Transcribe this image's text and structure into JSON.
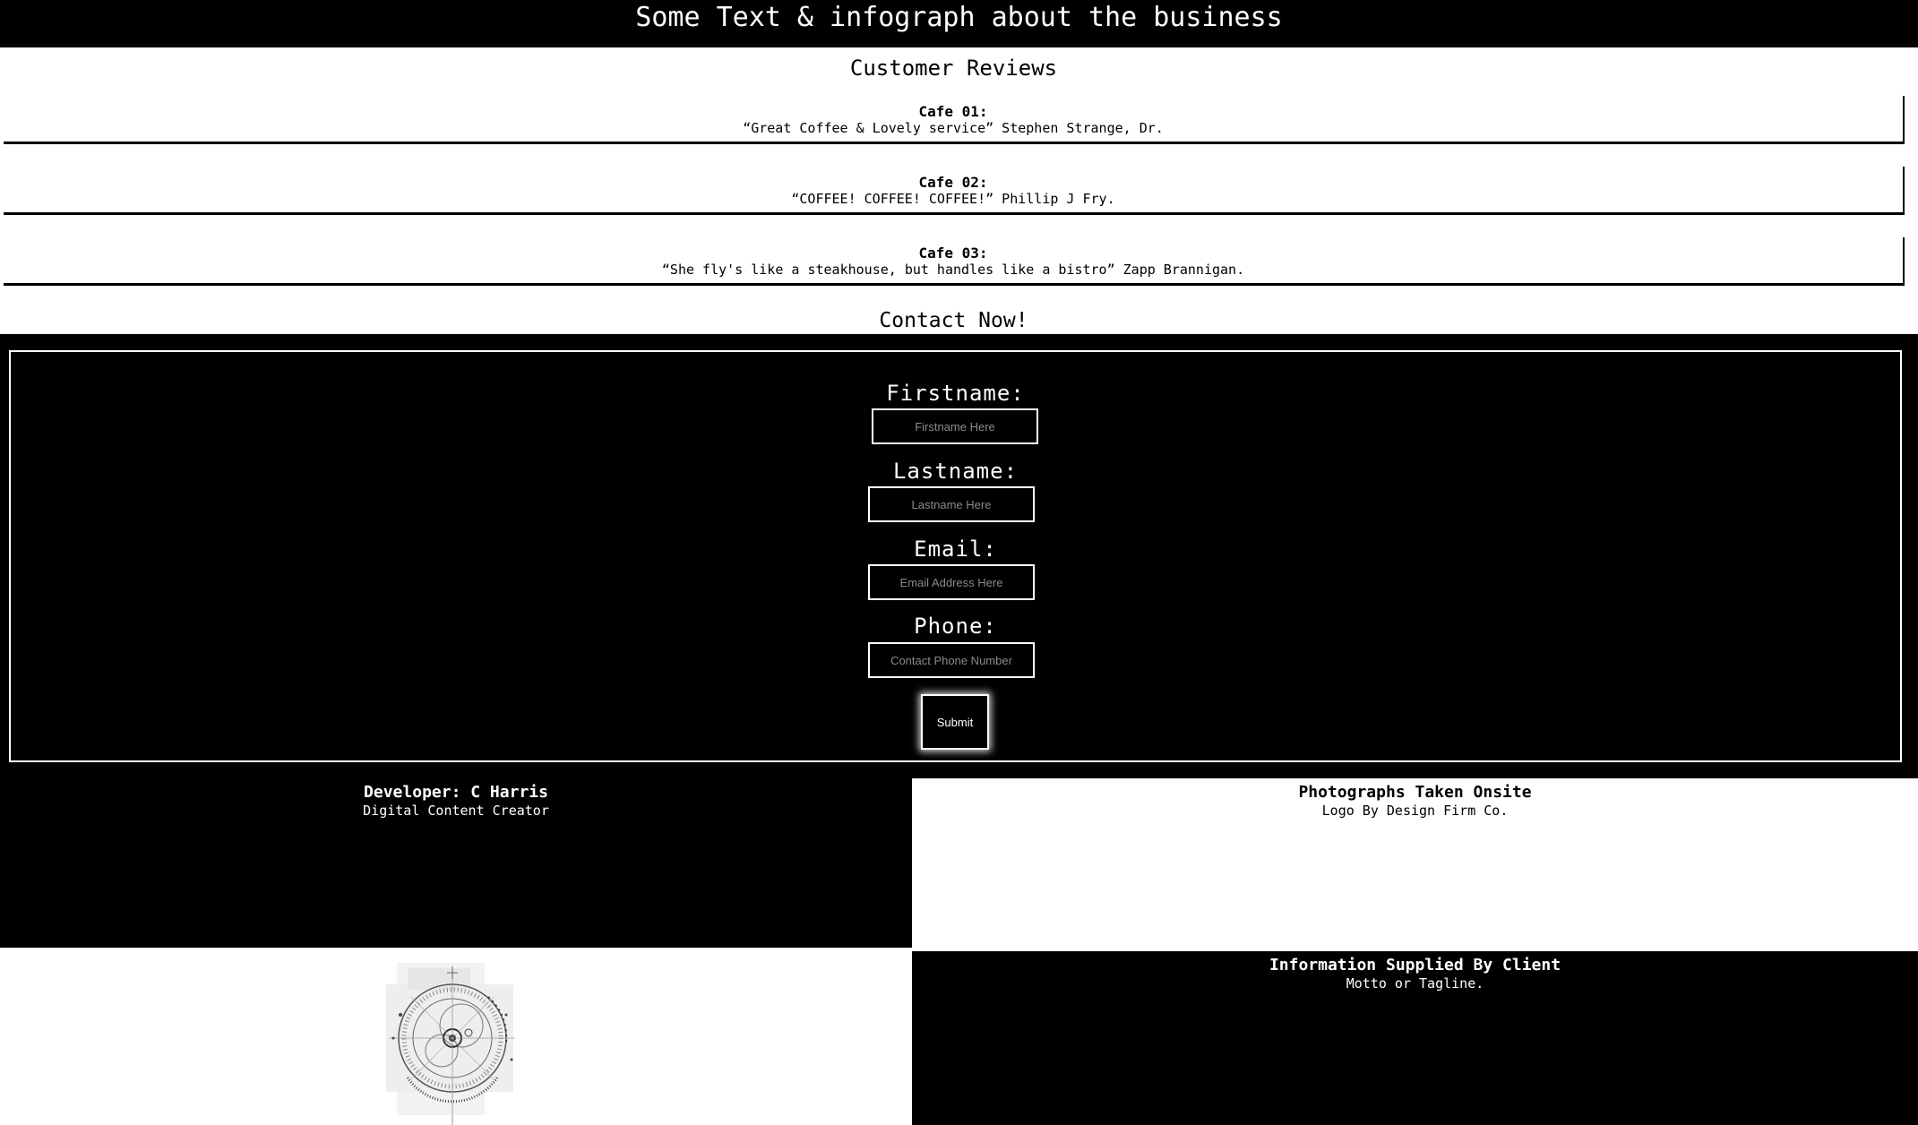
{
  "header": {
    "banner_text": "Some Text & infograph about the business"
  },
  "reviews": {
    "title": "Customer Reviews",
    "items": [
      {
        "name": "Cafe 01:",
        "quote": "“Great Coffee & Lovely service” Stephen Strange, Dr."
      },
      {
        "name": "Cafe 02:",
        "quote": "“COFFEE! COFFEE! COFFEE!” Phillip J Fry."
      },
      {
        "name": "Cafe 03:",
        "quote": "“She fly's like a steakhouse, but handles like a bistro” Zapp Brannigan."
      }
    ]
  },
  "contact": {
    "title": "Contact Now!",
    "fields": {
      "firstname": {
        "label": "Firstname:",
        "placeholder": "Firstname Here"
      },
      "lastname": {
        "label": "Lastname:",
        "placeholder": "Lastname Here"
      },
      "email": {
        "label": "Email:",
        "placeholder": "Email Address Here"
      },
      "phone": {
        "label": "Phone:",
        "placeholder": "Contact Phone Number"
      }
    },
    "submit_label": "Submit"
  },
  "footer": {
    "developer": {
      "heading": "Developer: C Harris",
      "sub": "Digital Content Creator"
    },
    "photos": {
      "heading": "Photographs Taken Onsite",
      "sub": "Logo By Design Firm Co."
    },
    "info": {
      "heading": "Information Supplied By Client",
      "sub": "Motto or Tagline."
    },
    "logo_icon": "circular-infograph-logo-icon"
  },
  "colors": {
    "background": "#ffffff",
    "dark": "#000000",
    "light_text": "#ffffff",
    "placeholder": "#8a8a8a"
  }
}
